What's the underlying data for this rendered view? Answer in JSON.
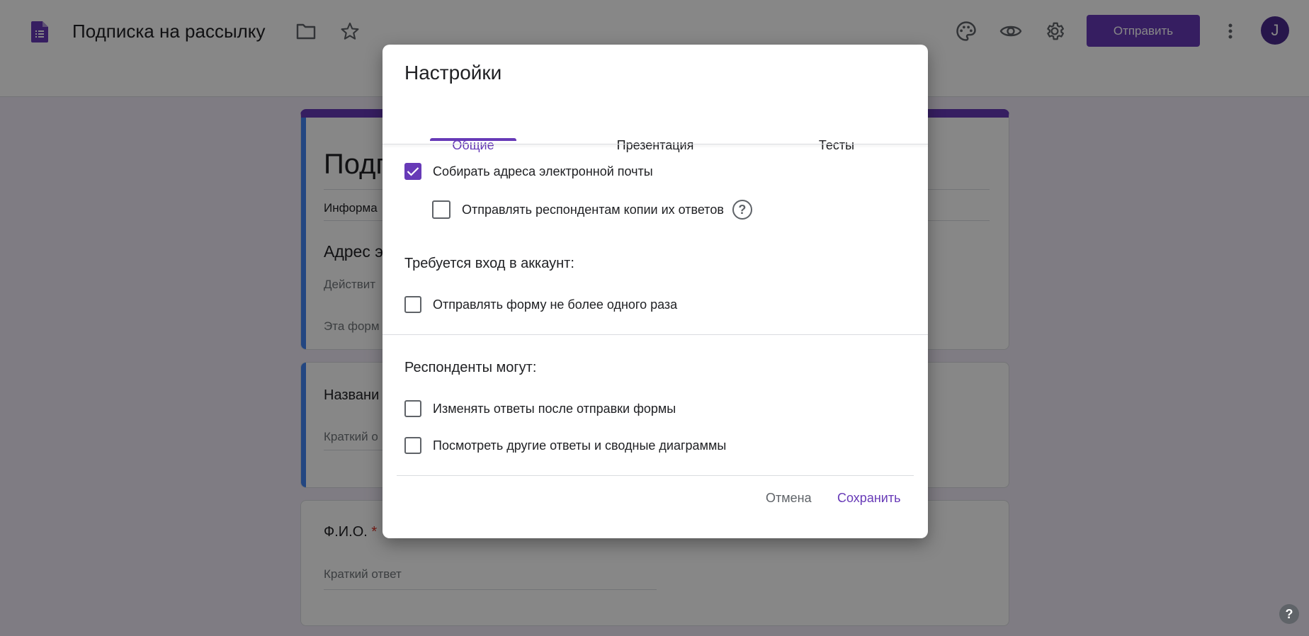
{
  "header": {
    "form_title": "Подписка на рассылку",
    "send_label": "Отправить",
    "avatar_letter": "J",
    "accent": "#673ab7"
  },
  "form": {
    "title_partial": "Подп",
    "description_partial": "Информа",
    "q1_title_partial": "Адрес э",
    "q1_hint_partial": "Действит",
    "q1_note_partial": "Эта форм",
    "q2_title_partial": "Названи",
    "q2_placeholder_partial": "Краткий о",
    "q3_title": "Ф.И.О.",
    "q3_required_mark": "*",
    "q3_placeholder": "Краткий ответ"
  },
  "dialog": {
    "title": "Настройки",
    "tabs": [
      {
        "label": "Общие",
        "active": true
      },
      {
        "label": "Презентация",
        "active": false
      },
      {
        "label": "Тесты",
        "active": false
      }
    ],
    "options": {
      "collect_emails": {
        "label": "Собирать адреса электронной почты",
        "checked": true
      },
      "send_copies": {
        "label": "Отправлять респондентам копии их ответов",
        "checked": false
      },
      "limit_one": {
        "label": "Отправлять форму не более одного раза",
        "checked": false
      },
      "edit_after": {
        "label": "Изменять ответы после отправки формы",
        "checked": false
      },
      "see_summary": {
        "label": "Посмотреть другие ответы и сводные диаграммы",
        "checked": false
      }
    },
    "section_signin": "Требуется вход в аккаунт:",
    "section_respondents": "Респонденты могут:",
    "cancel_label": "Отмена",
    "save_label": "Сохранить"
  },
  "icons": [
    "forms-doc-icon",
    "folder-icon",
    "star-icon",
    "palette-icon",
    "eye-icon",
    "gear-icon",
    "more-vert-icon",
    "help-icon",
    "check-icon"
  ]
}
